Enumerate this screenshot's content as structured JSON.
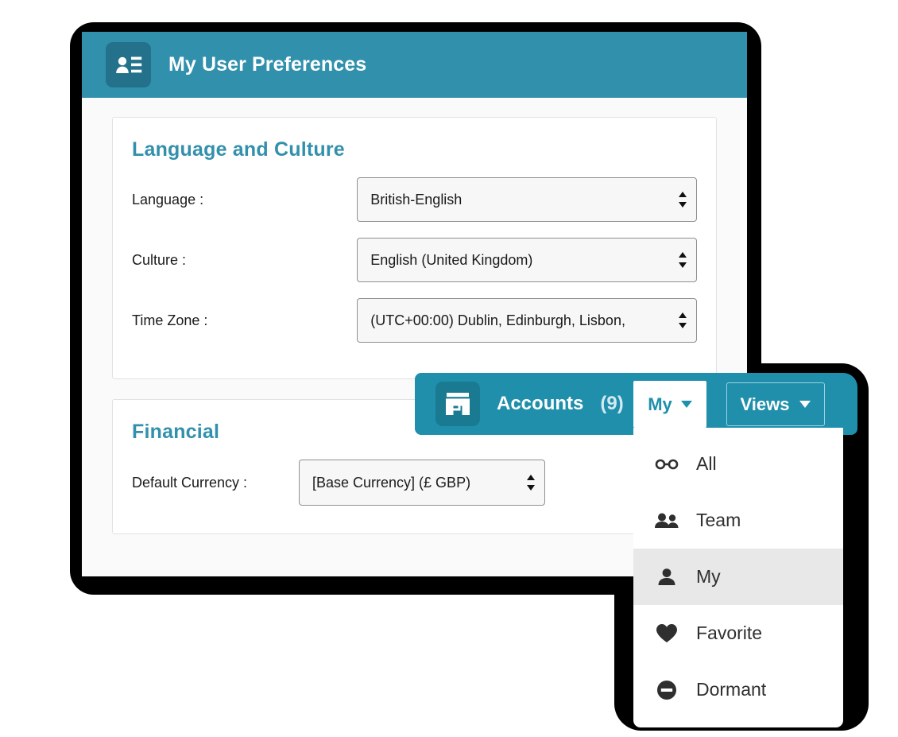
{
  "preferences_window": {
    "header": {
      "title": "My User Preferences",
      "icon": "user-card-icon",
      "bg_color": "#3190ac",
      "icon_box_color": "#23718a"
    },
    "sections": [
      {
        "title": "Language and Culture",
        "title_color": "#3390ac",
        "fields": [
          {
            "label": "Language :",
            "value": "British-English",
            "control": "select"
          },
          {
            "label": "Culture :",
            "value": "English (United Kingdom)",
            "control": "select"
          },
          {
            "label": "Time Zone :",
            "value": "(UTC+00:00) Dublin, Edinburgh, Lisbon,",
            "control": "select"
          }
        ]
      },
      {
        "title": "Financial",
        "title_color": "#3390ac",
        "fields": [
          {
            "label": "Default Currency :",
            "value": "[Base Currency] (£ GBP)",
            "control": "select"
          }
        ]
      }
    ]
  },
  "accounts_panel": {
    "bar": {
      "icon": "shop-icon",
      "label": "Accounts",
      "count": "(9)",
      "bg_color": "#1f8fab",
      "icon_box_color": "#1a7a92"
    },
    "my_button": {
      "label": "My",
      "caret": "chevron-down-icon",
      "text_color": "#1f8fab"
    },
    "views_button": {
      "label": "Views",
      "caret": "chevron-down-icon",
      "text_color": "#ffffff"
    },
    "menu": {
      "items": [
        {
          "label": "All",
          "icon": "infinity-icon",
          "active": false
        },
        {
          "label": "Team",
          "icon": "people-icon",
          "active": false
        },
        {
          "label": "My",
          "icon": "person-icon",
          "active": true
        },
        {
          "label": "Favorite",
          "icon": "heart-icon",
          "active": false
        },
        {
          "label": "Dormant",
          "icon": "minus-circle-icon",
          "active": false
        }
      ],
      "highlight_color": "#e8e8e8"
    }
  }
}
